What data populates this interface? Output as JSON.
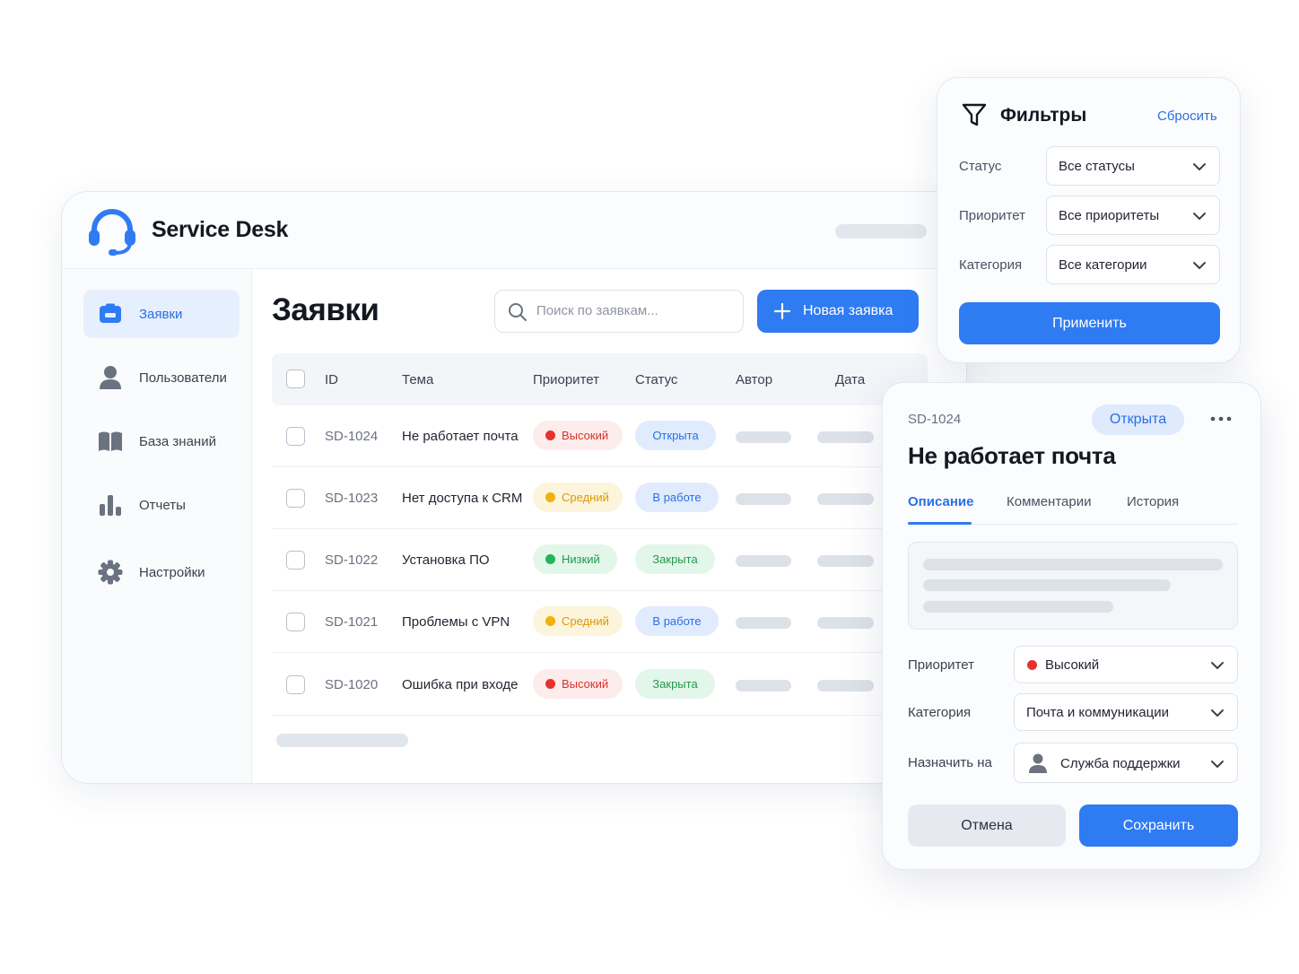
{
  "app": {
    "title": "Service Desk"
  },
  "sidebar": {
    "items": [
      {
        "label": "Заявки",
        "icon": "ticket-icon",
        "active": true
      },
      {
        "label": "Пользователи",
        "icon": "user-icon"
      },
      {
        "label": "База знаний",
        "icon": "book-icon"
      },
      {
        "label": "Отчеты",
        "icon": "bar-chart-icon"
      },
      {
        "label": "Настройки",
        "icon": "gear-icon"
      }
    ]
  },
  "main": {
    "title": "Заявки",
    "search": {
      "placeholder": "Поиск по заявкам..."
    },
    "new_button_label": "Новая заявка",
    "table": {
      "columns": [
        "ID",
        "Тема",
        "Приоритет",
        "Статус",
        "Автор",
        "Дата"
      ],
      "rows": [
        {
          "id": "SD-1024",
          "subject": "Не работает почта",
          "priority": "Высокий",
          "status": "Открыта"
        },
        {
          "id": "SD-1023",
          "subject": "Нет доступа к CRM",
          "priority": "Средний",
          "status": "В работе"
        },
        {
          "id": "SD-1022",
          "subject": "Установка ПО",
          "priority": "Низкий",
          "status": "Закрыта"
        },
        {
          "id": "SD-1021",
          "subject": "Проблемы с VPN",
          "priority": "Средний",
          "status": "В работе"
        },
        {
          "id": "SD-1020",
          "subject": "Ошибка при входе",
          "priority": "Высокий",
          "status": "Закрыта"
        }
      ]
    }
  },
  "colors": {
    "accent": "#2f7bf2",
    "priority": {
      "Высокий": {
        "bg": "#fdecec",
        "fg": "#d8322b",
        "dot": "#e5322b"
      },
      "Средний": {
        "bg": "#fdf4dc",
        "fg": "#d99a06",
        "dot": "#f0b10b"
      },
      "Низкий": {
        "bg": "#e3f6ea",
        "fg": "#1f9a4b",
        "dot": "#22b55a"
      }
    },
    "status": {
      "Открыта": {
        "bg": "#e0ebfd",
        "fg": "#2a6fe6"
      },
      "В работе": {
        "bg": "#e0ebfd",
        "fg": "#2a6fe6"
      },
      "Закрыта": {
        "bg": "#e3f6ea",
        "fg": "#22994c"
      }
    }
  },
  "filters": {
    "title": "Фильтры",
    "reset_label": "Сбросить",
    "fields": [
      {
        "label": "Статус",
        "value": "Все статусы"
      },
      {
        "label": "Приоритет",
        "value": "Все приоритеты"
      },
      {
        "label": "Категория",
        "value": "Все категории"
      }
    ],
    "apply_label": "Применить"
  },
  "detail": {
    "id": "SD-1024",
    "status": "Открыта",
    "title": "Не работает почта",
    "tabs": [
      "Описание",
      "Комментарии",
      "История"
    ],
    "active_tab": "Описание",
    "fields": {
      "priority": {
        "label": "Приоритет",
        "value": "Высокий"
      },
      "category": {
        "label": "Категория",
        "value": "Почта и коммуникации"
      },
      "assignee": {
        "label": "Назначить на",
        "value": "Служба поддержки"
      }
    },
    "cancel_label": "Отмена",
    "save_label": "Сохранить"
  }
}
